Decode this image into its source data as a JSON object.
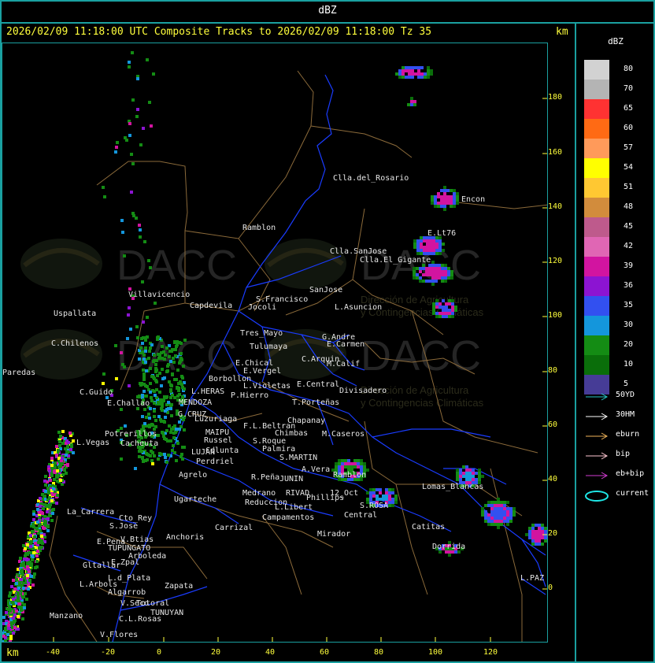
{
  "header": {
    "title": "dBZ"
  },
  "subtitle": "2026/02/09 11:18:00 UTC Composite Tracks to 2026/02/09 11:18:00 Tz 35",
  "units": {
    "top": "km",
    "bottom": "km"
  },
  "legend": {
    "title": "dBZ",
    "scale": [
      {
        "label": "80",
        "color": "#d2d2d2"
      },
      {
        "label": "70",
        "color": "#b4b4b4"
      },
      {
        "label": "65",
        "color": "#ff3232"
      },
      {
        "label": "60",
        "color": "#ff6a14"
      },
      {
        "label": "57",
        "color": "#ff9a5a"
      },
      {
        "label": "54",
        "color": "#ffff00"
      },
      {
        "label": "51",
        "color": "#ffc832"
      },
      {
        "label": "48",
        "color": "#d28c3c"
      },
      {
        "label": "45",
        "color": "#be5a8c"
      },
      {
        "label": "42",
        "color": "#e066b4"
      },
      {
        "label": "39",
        "color": "#d214a0"
      },
      {
        "label": "36",
        "color": "#8c14d2"
      },
      {
        "label": "35",
        "color": "#3250f0"
      },
      {
        "label": "30",
        "color": "#1496dc"
      },
      {
        "label": "20",
        "color": "#148c14"
      },
      {
        "label": "10",
        "color": "#0a6e0a"
      },
      {
        "label": "5",
        "color": "#463c96"
      }
    ],
    "tracks": [
      {
        "label": "50YD",
        "color": "#28c8c8"
      },
      {
        "label": "30HM",
        "color": "#ffffff"
      },
      {
        "label": "eburn",
        "color": "#f0b45a"
      },
      {
        "label": "bip",
        "color": "#ffc8d2"
      },
      {
        "label": "eb+bip",
        "color": "#d23cd2"
      },
      {
        "label": "current",
        "color": "#1ee6e6"
      }
    ]
  },
  "axes": {
    "y_ticks": [
      "180",
      "160",
      "140",
      "120",
      "100",
      "80",
      "60",
      "40",
      "20",
      "0"
    ],
    "x_ticks": [
      "-40",
      "-20",
      "0",
      "20",
      "40",
      "60",
      "80",
      "100",
      "120"
    ]
  },
  "watermark": {
    "brand": "DACC",
    "line1": "Dirección de Agricultura",
    "line2": "y Contingencias Climáticas"
  },
  "places": [
    {
      "name": "Clla.del_Rosario"
    },
    {
      "name": "Encon"
    },
    {
      "name": "Ramblon"
    },
    {
      "name": "Clla.SanJose"
    },
    {
      "name": "E.Lt76"
    },
    {
      "name": "Clla.El_Gigante"
    },
    {
      "name": "Villavicencio"
    },
    {
      "name": "Capdevila"
    },
    {
      "name": "S.Francisco"
    },
    {
      "name": "SanJose"
    },
    {
      "name": "Jocoli"
    },
    {
      "name": "L.Asuncion"
    },
    {
      "name": "Uspallata"
    },
    {
      "name": "Tres_Mayo"
    },
    {
      "name": "G.Andre"
    },
    {
      "name": "C.Chilenos"
    },
    {
      "name": "Tulumaya"
    },
    {
      "name": "E.Carmen"
    },
    {
      "name": "E.Chical"
    },
    {
      "name": "C.Arquin"
    },
    {
      "name": "E.Vergel"
    },
    {
      "name": "M.Calif"
    },
    {
      "name": "Paredas"
    },
    {
      "name": "Borbollon"
    },
    {
      "name": "L.Violetas"
    },
    {
      "name": "E.Central"
    },
    {
      "name": "C.Guido"
    },
    {
      "name": "L.HERAS"
    },
    {
      "name": "P.Hierro"
    },
    {
      "name": "Divisadero"
    },
    {
      "name": "E.Challao"
    },
    {
      "name": "MENDOZA"
    },
    {
      "name": "T.Porteñas"
    },
    {
      "name": "G.CRUZ"
    },
    {
      "name": "Luzuriaga"
    },
    {
      "name": "F.L.Beltran"
    },
    {
      "name": "Chapanay"
    },
    {
      "name": "Potrerillos"
    },
    {
      "name": "Russel"
    },
    {
      "name": "Palmira"
    },
    {
      "name": "Chimbas"
    },
    {
      "name": "M.Caseros"
    },
    {
      "name": "L.Vegas"
    },
    {
      "name": "Cacheuta"
    },
    {
      "name": "MAIPU"
    },
    {
      "name": "LUJAN"
    },
    {
      "name": "S.Roque"
    },
    {
      "name": "Cdlunta"
    },
    {
      "name": "Perdriel"
    },
    {
      "name": "S.MARTIN"
    },
    {
      "name": "Agrelo"
    },
    {
      "name": "A.Vera"
    },
    {
      "name": "Ramblon"
    },
    {
      "name": "R.Peña"
    },
    {
      "name": "JUNIN"
    },
    {
      "name": "Lomas_Blancas"
    },
    {
      "name": "Ugarteche"
    },
    {
      "name": "Medrano"
    },
    {
      "name": "RIVAD"
    },
    {
      "name": "Phillips"
    },
    {
      "name": "12_Oct"
    },
    {
      "name": "Reduccion"
    },
    {
      "name": "L.Libert"
    },
    {
      "name": "S.ROSA"
    },
    {
      "name": "La_Carrera"
    },
    {
      "name": "Cto_Rey"
    },
    {
      "name": "Campamentos"
    },
    {
      "name": "Central"
    },
    {
      "name": "S.Jose"
    },
    {
      "name": "Carrizal"
    },
    {
      "name": "Catitas"
    },
    {
      "name": "E.Pena"
    },
    {
      "name": "V.Btias"
    },
    {
      "name": "Anchoris"
    },
    {
      "name": "Mirador"
    },
    {
      "name": "TUPUNGATO"
    },
    {
      "name": "Arboleda"
    },
    {
      "name": "Dorrida"
    },
    {
      "name": "Gltallar"
    },
    {
      "name": "E.Zpal"
    },
    {
      "name": "L.d_Plata"
    },
    {
      "name": "L.Arbols"
    },
    {
      "name": "Zapata"
    },
    {
      "name": "L.PAZ"
    },
    {
      "name": "Algarrob"
    },
    {
      "name": "V.Seco"
    },
    {
      "name": "Totoral"
    },
    {
      "name": "Manzano"
    },
    {
      "name": "TUNUYAN"
    },
    {
      "name": "C.L.Rosas"
    },
    {
      "name": "V.Flores"
    }
  ]
}
